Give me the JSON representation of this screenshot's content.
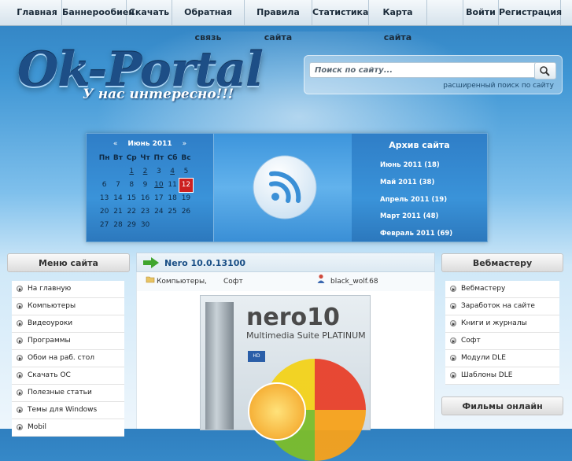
{
  "nav": {
    "items": [
      "Главная",
      "Баннерообиен",
      "Скачать",
      "Обратная связь",
      "Правила сайта",
      "Статистика",
      "Карта сайта"
    ],
    "login": "Войти",
    "register": "Регистрация"
  },
  "header": {
    "logo": "Ok-Portal",
    "slogan": "У нас интересно!!!"
  },
  "search": {
    "placeholder": "Поиск по сайту...",
    "advanced": "расширенный поиск по сайту"
  },
  "calendar": {
    "prev": "«",
    "month": "Июнь 2011",
    "next": "»",
    "weekdays": [
      "Пн",
      "Вт",
      "Ср",
      "Чт",
      "Пт",
      "Сб",
      "Вс"
    ],
    "weeks": [
      [
        "",
        "",
        "1",
        "2",
        "3",
        "4",
        "5"
      ],
      [
        "6",
        "7",
        "8",
        "9",
        "10",
        "11",
        "12"
      ],
      [
        "13",
        "14",
        "15",
        "16",
        "17",
        "18",
        "19"
      ],
      [
        "20",
        "21",
        "22",
        "23",
        "24",
        "25",
        "26"
      ],
      [
        "27",
        "28",
        "29",
        "30",
        "",
        "",
        ""
      ]
    ],
    "linked_days": [
      "1",
      "2",
      "4",
      "10"
    ],
    "today": "12"
  },
  "archive": {
    "title": "Архив сайта",
    "items": [
      "Июнь 2011 (18)",
      "Май 2011 (38)",
      "Апрель 2011 (19)",
      "Март 2011 (48)",
      "Февраль 2011 (69)"
    ]
  },
  "left_menu": {
    "title": "Меню сайта",
    "items": [
      "На главную",
      "Компьютеры",
      "Видеоуроки",
      "Программы",
      "Обои на раб. стол",
      "Скачать ОС",
      "Полезные статьи",
      "Темы для Windows",
      "Mobil"
    ]
  },
  "right_menu": {
    "title": "Вебмастеру",
    "items": [
      "Вебмастеру",
      "Заработок на сайте",
      "Книги и журналы",
      "Софт",
      "Модули DLE",
      "Шаблоны DLE"
    ],
    "title2": "Фильмы онлайн"
  },
  "article": {
    "title": "Nero 10.0.13100",
    "category1": "Компьютеры,",
    "category2": "Софт",
    "author": "black_wolf.68",
    "product_logo": "nero10",
    "product_line": "Multimedia Suite PLATINUM",
    "product_small": "HD"
  },
  "colors": {
    "accent": "#1a4f86",
    "today": "#cc2020",
    "banner_blue": "#3a93d9"
  }
}
